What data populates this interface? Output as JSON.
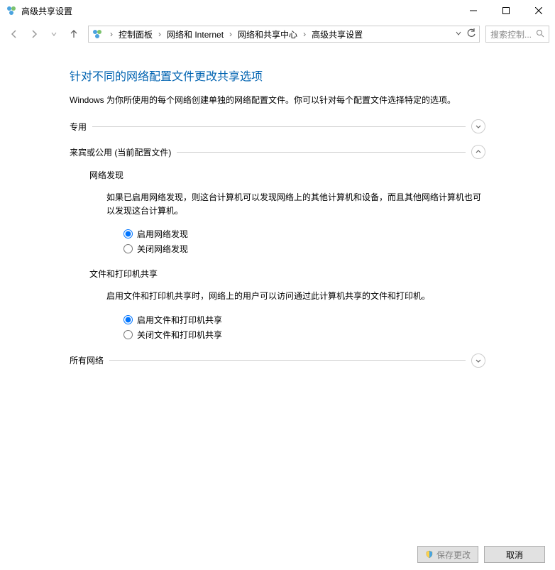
{
  "window": {
    "title": "高级共享设置"
  },
  "breadcrumb": {
    "items": [
      "控制面板",
      "网络和 Internet",
      "网络和共享中心",
      "高级共享设置"
    ]
  },
  "search": {
    "placeholder": "搜索控制..."
  },
  "page": {
    "title": "针对不同的网络配置文件更改共享选项",
    "description": "Windows 为你所使用的每个网络创建单独的网络配置文件。你可以针对每个配置文件选择特定的选项。"
  },
  "profiles": {
    "private": {
      "label": "专用",
      "expanded": false
    },
    "guest": {
      "label": "来宾或公用 (当前配置文件)",
      "expanded": true,
      "sections": {
        "discovery": {
          "title": "网络发现",
          "desc": "如果已启用网络发现，则这台计算机可以发现网络上的其他计算机和设备，而且其他网络计算机也可以发现这台计算机。",
          "options": {
            "on": "启用网络发现",
            "off": "关闭网络发现"
          },
          "selected": "on"
        },
        "sharing": {
          "title": "文件和打印机共享",
          "desc": "启用文件和打印机共享时，网络上的用户可以访问通过此计算机共享的文件和打印机。",
          "options": {
            "on": "启用文件和打印机共享",
            "off": "关闭文件和打印机共享"
          },
          "selected": "on"
        }
      }
    },
    "all": {
      "label": "所有网络",
      "expanded": false
    }
  },
  "footer": {
    "save": "保存更改",
    "cancel": "取消"
  }
}
